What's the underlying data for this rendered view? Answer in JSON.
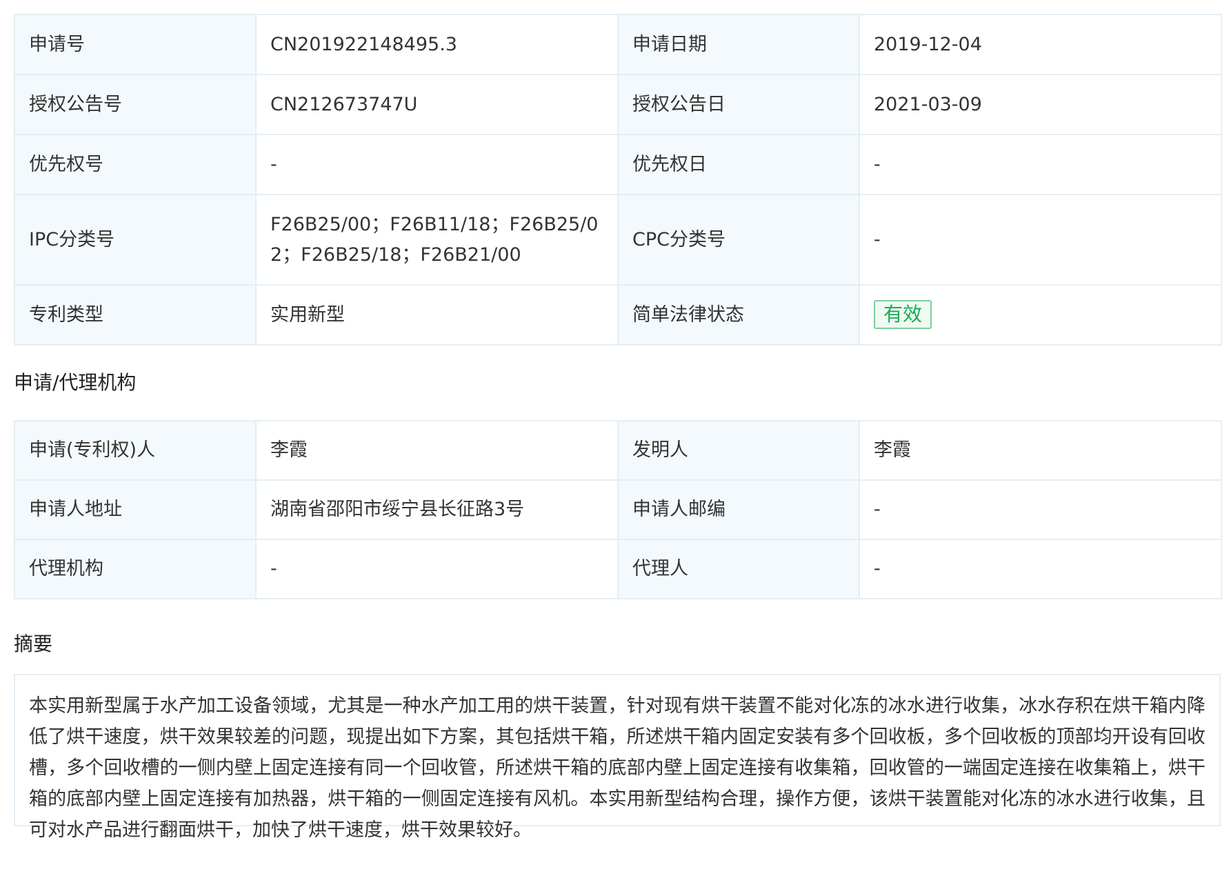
{
  "patent_info": {
    "rows": [
      {
        "l1": "申请号",
        "v1": "CN201922148495.3",
        "l2": "申请日期",
        "v2": "2019-12-04"
      },
      {
        "l1": "授权公告号",
        "v1": "CN212673747U",
        "l2": "授权公告日",
        "v2": "2021-03-09"
      },
      {
        "l1": "优先权号",
        "v1": "-",
        "l2": "优先权日",
        "v2": "-"
      },
      {
        "l1": "IPC分类号",
        "v1": "F26B25/00；F26B11/18；F26B25/02；F26B25/18；F26B21/00",
        "l2": "CPC分类号",
        "v2": "-"
      },
      {
        "l1": "专利类型",
        "v1": "实用新型",
        "l2": "简单法律状态",
        "v2": "有效"
      }
    ]
  },
  "agency_section": {
    "title": "申请/代理机构",
    "rows": [
      {
        "l1": "申请(专利权)人",
        "v1": "李霞",
        "l2": "发明人",
        "v2": "李霞"
      },
      {
        "l1": "申请人地址",
        "v1": "湖南省邵阳市绥宁县长征路3号",
        "l2": "申请人邮编",
        "v2": "-"
      },
      {
        "l1": "代理机构",
        "v1": "-",
        "l2": "代理人",
        "v2": "-"
      }
    ]
  },
  "abstract_section": {
    "title": "摘要",
    "text": "本实用新型属于水产加工设备领域，尤其是一种水产加工用的烘干装置，针对现有烘干装置不能对化冻的冰水进行收集，冰水存积在烘干箱内降低了烘干速度，烘干效果较差的问题，现提出如下方案，其包括烘干箱，所述烘干箱内固定安装有多个回收板，多个回收板的顶部均开设有回收槽，多个回收槽的一侧内壁上固定连接有同一个回收管，所述烘干箱的底部内壁上固定连接有收集箱，回收管的一端固定连接在收集箱上，烘干箱的底部内壁上固定连接有加热器，烘干箱的一侧固定连接有风机。本实用新型结构合理，操作方便，该烘干装置能对化冻的冰水进行收集，且可对水产品进行翻面烘干，加快了烘干速度，烘干效果较好。"
  },
  "colors": {
    "label_bg": "#f3f9fc",
    "border": "#e4eef5",
    "status_green": "#1aaa55"
  }
}
